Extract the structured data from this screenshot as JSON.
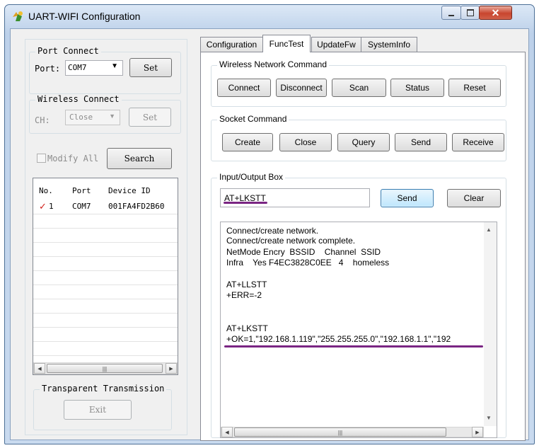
{
  "window": {
    "title": "UART-WIFI Configuration"
  },
  "tabs": [
    {
      "label": "Configuration"
    },
    {
      "label": "FuncTest"
    },
    {
      "label": "UpdateFw"
    },
    {
      "label": "SystemInfo"
    }
  ],
  "port_connect": {
    "legend": "Port Connect",
    "port_label": "Port:",
    "port_value": "COM7",
    "set_label": "Set"
  },
  "wireless_connect": {
    "legend": "Wireless Connect",
    "ch_label": "CH:",
    "ch_value": "Close",
    "set_label": "Set"
  },
  "modify_all": {
    "label": "Modify All",
    "checked": false
  },
  "search_button": "Search",
  "device_list": {
    "columns": [
      "No.",
      "Port",
      "Device ID"
    ],
    "rows": [
      {
        "mark": "✓",
        "no": "1",
        "port": "COM7",
        "device_id": "001FA4FD2B60"
      }
    ]
  },
  "transparent": {
    "legend": "Transparent Transmission",
    "exit_label": "Exit"
  },
  "wireless_cmd": {
    "legend": "Wireless Network Command",
    "buttons": [
      "Connect",
      "Disconnect",
      "Scan",
      "Status",
      "Reset"
    ]
  },
  "socket_cmd": {
    "legend": "Socket Command",
    "buttons": [
      "Create",
      "Close",
      "Query",
      "Send",
      "Receive"
    ]
  },
  "io_box": {
    "legend": "Input/Output Box",
    "input_value": "AT+LKSTT",
    "send_label": "Send",
    "clear_label": "Clear",
    "output_lines": [
      "Connect/create network.",
      "Connect/create network complete.",
      "NetMode Encry  BSSID    Channel  SSID",
      "Infra    Yes F4EC3828C0EE   4    homeless",
      "",
      "AT+LLSTT",
      "+ERR=-2",
      "",
      "",
      "AT+LKSTT",
      "+OK=1,\"192.168.1.119\",\"255.255.255.0\",\"192.168.1.1\",\"192"
    ]
  },
  "colors": {
    "accent": "#3c7fb1",
    "annotation": "#7a2583",
    "check_mark": "#d0201a"
  },
  "scroll_thumb_glyph": "|||"
}
